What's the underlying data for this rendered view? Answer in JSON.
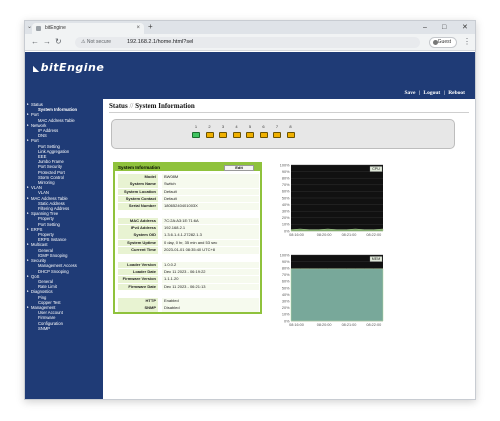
{
  "browser": {
    "tab_title": "bitEngine",
    "url_security": "Not secure",
    "url": "192.168.2.1/home.html?sel",
    "profile": "Guest"
  },
  "header": {
    "logo": "bitEngine",
    "links": [
      "Save",
      "Logout",
      "Reboot"
    ],
    "separator": "|"
  },
  "sidebar": [
    {
      "label": "Status",
      "level": 0
    },
    {
      "label": "System Information",
      "level": 1,
      "active": true
    },
    {
      "label": "Port",
      "level": 0
    },
    {
      "label": "MAC Address Table",
      "level": 1
    },
    {
      "label": "Network",
      "level": 0
    },
    {
      "label": "IP Address",
      "level": 1
    },
    {
      "label": "DNS",
      "level": 1
    },
    {
      "label": "Port",
      "level": 0
    },
    {
      "label": "Port Setting",
      "level": 1
    },
    {
      "label": "Link Aggregation",
      "level": 1
    },
    {
      "label": "EEE",
      "level": 1
    },
    {
      "label": "Jumbo Frame",
      "level": 1
    },
    {
      "label": "Port Security",
      "level": 1
    },
    {
      "label": "Protected Port",
      "level": 1
    },
    {
      "label": "Storm Control",
      "level": 1
    },
    {
      "label": "Mirroring",
      "level": 1
    },
    {
      "label": "VLAN",
      "level": 0
    },
    {
      "label": "VLAN",
      "level": 1
    },
    {
      "label": "MAC Address Table",
      "level": 0
    },
    {
      "label": "Static Address",
      "level": 1
    },
    {
      "label": "Filtering Address",
      "level": 1
    },
    {
      "label": "Spanning Tree",
      "level": 0
    },
    {
      "label": "Property",
      "level": 1
    },
    {
      "label": "Port Setting",
      "level": 1
    },
    {
      "label": "ERPS",
      "level": 0
    },
    {
      "label": "Property",
      "level": 1
    },
    {
      "label": "ERPS Instance",
      "level": 1
    },
    {
      "label": "Multicast",
      "level": 0
    },
    {
      "label": "General",
      "level": 1
    },
    {
      "label": "IGMP Snooping",
      "level": 1
    },
    {
      "label": "Security",
      "level": 0
    },
    {
      "label": "Management Access",
      "level": 1
    },
    {
      "label": "DHCP Snooping",
      "level": 1
    },
    {
      "label": "QoS",
      "level": 0
    },
    {
      "label": "General",
      "level": 1
    },
    {
      "label": "Rate Limit",
      "level": 1
    },
    {
      "label": "Diagnostics",
      "level": 0
    },
    {
      "label": "Ping",
      "level": 1
    },
    {
      "label": "Copper Test",
      "level": 1
    },
    {
      "label": "Management",
      "level": 0
    },
    {
      "label": "User Account",
      "level": 1
    },
    {
      "label": "Firmware",
      "level": 1
    },
    {
      "label": "Configuration",
      "level": 1
    },
    {
      "label": "SNMP",
      "level": 1
    }
  ],
  "page": {
    "breadcrumb_root": "Status",
    "breadcrumb_sep": "//",
    "title": "System Information"
  },
  "ports": [
    {
      "num": "1",
      "status": "up"
    },
    {
      "num": "2",
      "status": "down"
    },
    {
      "num": "3",
      "status": "down"
    },
    {
      "num": "4",
      "status": "down"
    },
    {
      "num": "5",
      "status": "down"
    },
    {
      "num": "6",
      "status": "down"
    },
    {
      "num": "7",
      "status": "down"
    },
    {
      "num": "8",
      "status": "down"
    }
  ],
  "info": {
    "heading": "System Information",
    "edit_label": "Edit",
    "rows": [
      {
        "k": "Model",
        "v": "BW08M"
      },
      {
        "k": "System Name",
        "v": "Switch"
      },
      {
        "k": "System Location",
        "v": "Default"
      },
      {
        "k": "System Contact",
        "v": "Default"
      },
      {
        "k": "Serial Number",
        "v": "18065240401003X"
      },
      {
        "k": "",
        "v": ""
      },
      {
        "k": "MAC Address",
        "v": "7C:2A:A3:1E:71:6A"
      },
      {
        "k": "IPv4 Address",
        "v": "192.168.2.1"
      },
      {
        "k": "System OID",
        "v": "1.3.6.1.4.1.27282.1.3"
      },
      {
        "k": "System Uptime",
        "v": "0 day, 0 hr, 35 min and 53 sec"
      },
      {
        "k": "Current Time",
        "v": "2023-01-01 08:35:40 UTC+8"
      },
      {
        "k": "",
        "v": ""
      },
      {
        "k": "Loader Version",
        "v": "1.0.0.2"
      },
      {
        "k": "Loader Date",
        "v": "Dec 11 2023 - 06:19:22"
      },
      {
        "k": "Firmware Version",
        "v": "1.1.1.20"
      },
      {
        "k": "Firmware Date",
        "v": "Dec 11 2023 - 06:21:13"
      },
      {
        "k": "",
        "v": ""
      },
      {
        "k": "HTTP",
        "v": "Enabled"
      },
      {
        "k": "SNMP",
        "v": "Disabled"
      }
    ]
  },
  "colors": {
    "header_bg": "#1f3b76",
    "info_border": "#8fc23c",
    "cpu_fill": "#6f9a5a",
    "mem_fill": "#78a89a",
    "port_up": "#3fc460",
    "port_down": "#f0b000"
  },
  "chart_data": [
    {
      "type": "area",
      "legend": "CPU",
      "y_tick_labels": [
        "100%",
        "90%",
        "80%",
        "70%",
        "60%",
        "50%",
        "40%",
        "30%",
        "20%",
        "10%",
        "0%"
      ],
      "x_tick_labels": [
        "08:16:00",
        "08:20:00",
        "08:21:00",
        "08:22:00"
      ],
      "ylim": [
        0,
        100
      ],
      "x": [
        0,
        10,
        20,
        30,
        40,
        50,
        60,
        70,
        80,
        90,
        100
      ],
      "values": [
        2,
        3,
        2,
        2,
        3,
        2,
        2,
        3,
        2,
        2,
        3
      ],
      "grid": true
    },
    {
      "type": "area",
      "legend": "MEM",
      "y_tick_labels": [
        "100%",
        "90%",
        "80%",
        "70%",
        "60%",
        "50%",
        "40%",
        "30%",
        "20%",
        "10%",
        "0%"
      ],
      "x_tick_labels": [
        "08:16:00",
        "08:20:00",
        "08:21:00",
        "08:22:00"
      ],
      "ylim": [
        0,
        100
      ],
      "x": [
        0,
        10,
        20,
        30,
        40,
        50,
        60,
        70,
        80,
        90,
        100
      ],
      "values": [
        79,
        79,
        79,
        79,
        79,
        79,
        79,
        79,
        79,
        79,
        79
      ],
      "grid": true
    }
  ]
}
